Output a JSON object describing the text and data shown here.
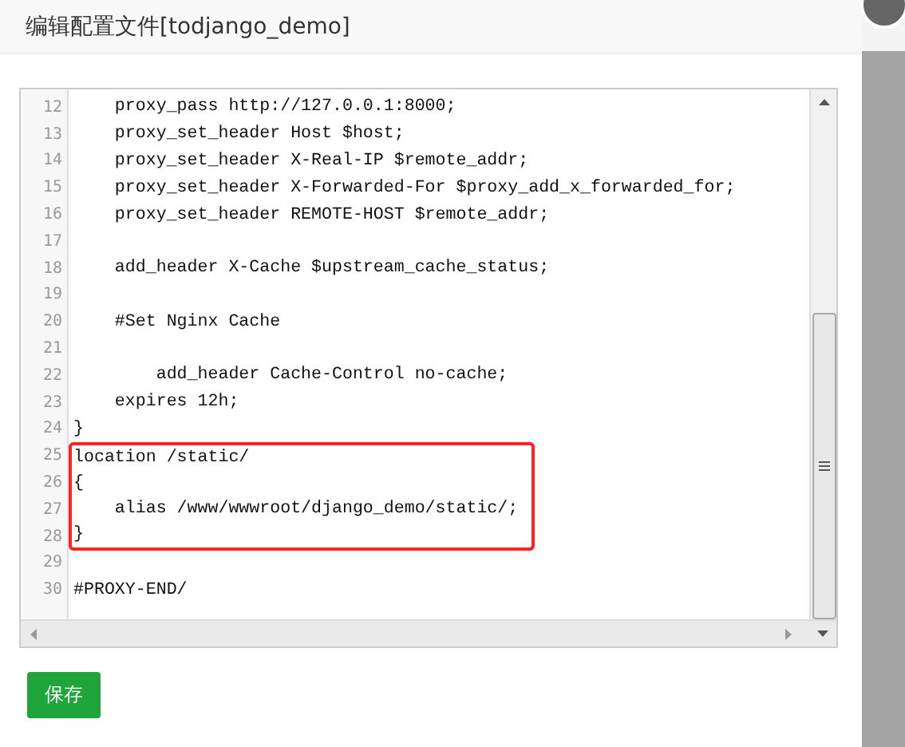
{
  "dialog": {
    "title": "编辑配置文件[todjango_demo]"
  },
  "editor": {
    "lines": [
      {
        "number": "12",
        "text": "    proxy_pass http://127.0.0.1:8000;",
        "highlighted": false
      },
      {
        "number": "13",
        "text": "    proxy_set_header Host $host;",
        "highlighted": false
      },
      {
        "number": "14",
        "text": "    proxy_set_header X-Real-IP $remote_addr;",
        "highlighted": false
      },
      {
        "number": "15",
        "text": "    proxy_set_header X-Forwarded-For $proxy_add_x_forwarded_for;",
        "highlighted": false
      },
      {
        "number": "16",
        "text": "    proxy_set_header REMOTE-HOST $remote_addr;",
        "highlighted": false
      },
      {
        "number": "17",
        "highlighted": false
      },
      {
        "number": "18",
        "text": "    add_header X-Cache $upstream_cache_status;",
        "highlighted": false
      },
      {
        "number": "19",
        "highlighted": false
      },
      {
        "number": "20",
        "text": "    #Set Nginx Cache",
        "highlighted": false
      },
      {
        "number": "21",
        "highlighted": false
      },
      {
        "number": "22",
        "text": "        add_header Cache-Control no-cache;",
        "highlighted": false
      },
      {
        "number": "23",
        "text": "    expires 12h;",
        "highlighted": false
      },
      {
        "number": "24",
        "text": "}",
        "highlighted": false
      },
      {
        "number": "25",
        "text": "location /static/",
        "highlighted": true
      },
      {
        "number": "26",
        "text": "{",
        "highlighted": true
      },
      {
        "number": "27",
        "text": "    alias /www/wwwroot/django_demo/static/;",
        "highlighted": true
      },
      {
        "number": "28",
        "text": "}",
        "highlighted": true
      },
      {
        "number": "29",
        "highlighted": false
      },
      {
        "number": "30",
        "text": "#PROXY-END/",
        "highlighted": false
      }
    ]
  },
  "buttons": [
    {
      "label": "保存"
    }
  ]
}
